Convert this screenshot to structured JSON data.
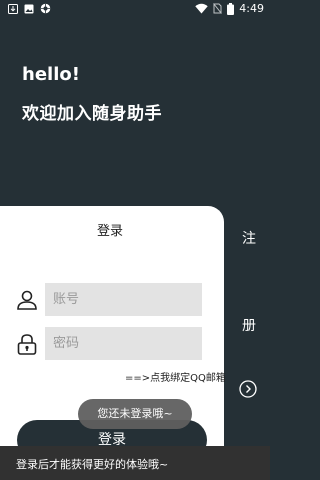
{
  "status_bar": {
    "time": "4:49",
    "left_icons": [
      "download-icon",
      "image-icon",
      "vpn-key-icon"
    ],
    "right_icons": [
      "wifi-icon",
      "no-sim-icon",
      "battery-icon"
    ]
  },
  "header": {
    "greeting": "hello!",
    "welcome": "欢迎加入随身助手"
  },
  "login": {
    "title": "登录",
    "account_placeholder": "账号",
    "password_placeholder": "密码",
    "qq_bind_link": "==>点我绑定QQ邮箱",
    "submit_label": "登录"
  },
  "register_tab": {
    "char_1": "注",
    "char_2": "册",
    "icon": "chevron-right-circle-icon"
  },
  "toast": {
    "message": "您还未登录哦~"
  },
  "snackbar": {
    "message": "登录后才能获得更好的体验哦~"
  },
  "colors": {
    "background": "#253036",
    "card": "#ffffff",
    "input_fill": "#e3e3e3",
    "toast": "#5f5f5f",
    "snackbar": "#313131"
  }
}
